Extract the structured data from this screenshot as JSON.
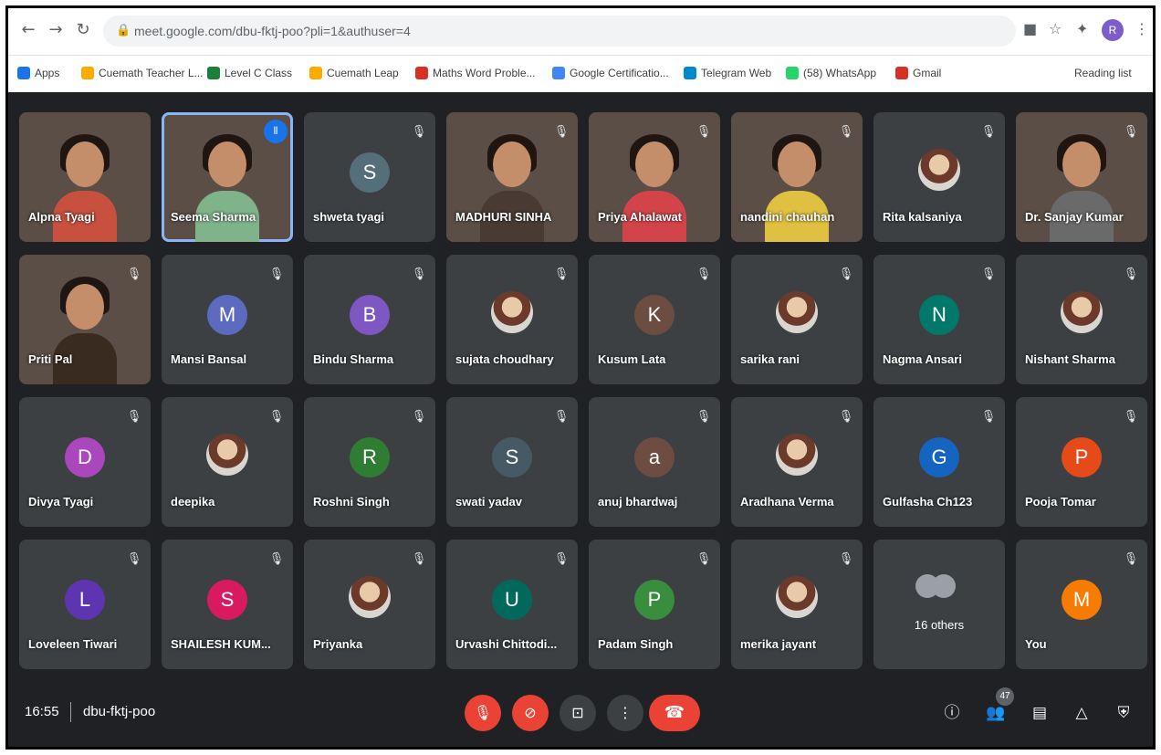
{
  "browser": {
    "url": "meet.google.com/dbu-fktj-poo?pli=1&authuser=4",
    "profile_initial": "R",
    "bookmarks": [
      "Apps",
      "Cuemath Teacher L...",
      "Level C Class",
      "Cuemath Leap",
      "Maths Word Proble...",
      "Google Certificatio...",
      "Telegram Web",
      "(58) WhatsApp",
      "Gmail"
    ],
    "reading_list": "Reading list"
  },
  "tiles": [
    {
      "name": "Alpna Tyagi",
      "kind": "video",
      "shirt": "#c7503f"
    },
    {
      "name": "Seema Sharma",
      "kind": "video",
      "shirt": "#7fb38a",
      "speaking": true
    },
    {
      "name": "shweta tyagi",
      "kind": "avatar",
      "initial": "S",
      "color": "#546e7a"
    },
    {
      "name": "MADHURI SINHA",
      "kind": "video",
      "shirt": "#4a3a34"
    },
    {
      "name": "Priya Ahalawat",
      "kind": "video",
      "shirt": "#d2444a"
    },
    {
      "name": "nandini chauhan",
      "kind": "video",
      "shirt": "#e0c040"
    },
    {
      "name": "Rita kalsaniya",
      "kind": "photo"
    },
    {
      "name": "Dr. Sanjay Kumar",
      "kind": "video",
      "shirt": "#6a6a6a"
    },
    {
      "name": "Priti Pal",
      "kind": "video",
      "shirt": "#3a2b20"
    },
    {
      "name": "Mansi Bansal",
      "kind": "avatar",
      "initial": "M",
      "color": "#5c6bc0"
    },
    {
      "name": "Bindu Sharma",
      "kind": "avatar",
      "initial": "B",
      "color": "#7e57c2"
    },
    {
      "name": "sujata choudhary",
      "kind": "photo"
    },
    {
      "name": "Kusum Lata",
      "kind": "avatar",
      "initial": "K",
      "color": "#6d4c41"
    },
    {
      "name": "sarika rani",
      "kind": "photo"
    },
    {
      "name": "Nagma Ansari",
      "kind": "avatar",
      "initial": "N",
      "color": "#00796b"
    },
    {
      "name": "Nishant Sharma",
      "kind": "photo"
    },
    {
      "name": "Divya Tyagi",
      "kind": "avatar",
      "initial": "D",
      "color": "#ab47bc"
    },
    {
      "name": "deepika",
      "kind": "photo"
    },
    {
      "name": "Roshni Singh",
      "kind": "avatar",
      "initial": "R",
      "color": "#2e7d32"
    },
    {
      "name": "swati yadav",
      "kind": "avatar",
      "initial": "S",
      "color": "#455a64"
    },
    {
      "name": "anuj bhardwaj",
      "kind": "avatar",
      "initial": "a",
      "color": "#6d4c41"
    },
    {
      "name": "Aradhana Verma",
      "kind": "photo"
    },
    {
      "name": "Gulfasha Ch123",
      "kind": "avatar",
      "initial": "G",
      "color": "#1565c0"
    },
    {
      "name": "Pooja Tomar",
      "kind": "avatar",
      "initial": "P",
      "color": "#e64a19"
    },
    {
      "name": "Loveleen Tiwari",
      "kind": "avatar",
      "initial": "L",
      "color": "#5e35b1"
    },
    {
      "name": "SHAILESH KUM...",
      "kind": "avatar",
      "initial": "S",
      "color": "#d81b60"
    },
    {
      "name": "Priyanka",
      "kind": "photo"
    },
    {
      "name": "Urvashi Chittodi...",
      "kind": "avatar",
      "initial": "U",
      "color": "#00695c"
    },
    {
      "name": "Padam Singh",
      "kind": "avatar",
      "initial": "P",
      "color": "#388e3c"
    },
    {
      "name": "merika jayant",
      "kind": "photo"
    },
    {
      "name": "16 others",
      "kind": "others"
    },
    {
      "name": "You",
      "kind": "avatar",
      "initial": "M",
      "color": "#f57c00"
    }
  ],
  "meeting": {
    "time": "16:55",
    "code": "dbu-fktj-poo",
    "participant_count": "47"
  },
  "icons": {
    "mic_off": "mic-off-icon",
    "cam_off": "camera-off-icon",
    "present": "present-icon",
    "more": "more-icon",
    "leave": "leave-call-icon",
    "info": "info-icon",
    "people": "people-icon",
    "chat": "chat-icon",
    "activities": "activities-icon",
    "host": "host-controls-icon"
  }
}
